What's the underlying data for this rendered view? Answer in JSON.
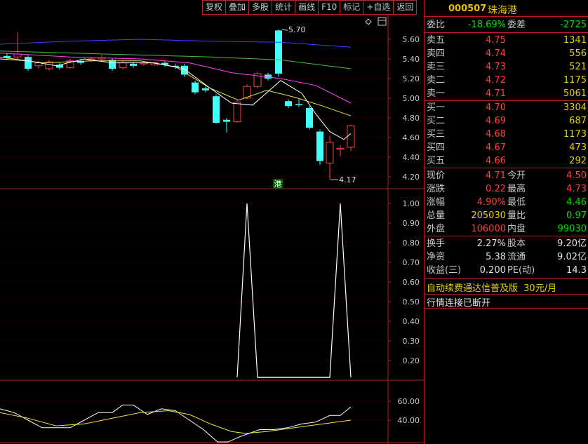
{
  "toolbar": {
    "buttons": [
      "复权",
      "叠加",
      "多股",
      "统计",
      "画线",
      "F10",
      "标记",
      "+自选",
      "返回"
    ]
  },
  "stock": {
    "code": "000507",
    "name": "珠海港"
  },
  "main_chart": {
    "y_ticks": [
      "5.60",
      "5.40",
      "5.20",
      "5.00",
      "4.80",
      "4.60",
      "4.40",
      "4.20"
    ],
    "high_label": "5.70",
    "low_label": "4.17",
    "badge": "港"
  },
  "indicator1": {
    "y_ticks": [
      "1.00",
      "0.90",
      "0.80",
      "0.70",
      "0.60",
      "0.50",
      "0.40",
      "0.30",
      "0.20"
    ]
  },
  "indicator2": {
    "y_ticks": [
      "60.00",
      "40.00"
    ]
  },
  "quote": {
    "weibi_label": "委比",
    "weibi": "-18.69%",
    "weicha_label": "委差",
    "weicha": "-2725",
    "sells": [
      {
        "label": "卖五",
        "price": "4.75",
        "vol": "1341"
      },
      {
        "label": "卖四",
        "price": "4.74",
        "vol": "556"
      },
      {
        "label": "卖三",
        "price": "4.73",
        "vol": "521"
      },
      {
        "label": "卖二",
        "price": "4.72",
        "vol": "1175"
      },
      {
        "label": "卖一",
        "price": "4.71",
        "vol": "5061"
      }
    ],
    "buys": [
      {
        "label": "买一",
        "price": "4.70",
        "vol": "3304"
      },
      {
        "label": "买二",
        "price": "4.69",
        "vol": "687"
      },
      {
        "label": "买三",
        "price": "4.68",
        "vol": "1173"
      },
      {
        "label": "买四",
        "price": "4.67",
        "vol": "473"
      },
      {
        "label": "买五",
        "price": "4.66",
        "vol": "292"
      }
    ],
    "stats": [
      {
        "l1": "现价",
        "v1": "4.71",
        "c1": "red",
        "l2": "今开",
        "v2": "4.50",
        "c2": "red"
      },
      {
        "l1": "涨跌",
        "v1": "0.22",
        "c1": "red",
        "l2": "最高",
        "v2": "4.73",
        "c2": "red"
      },
      {
        "l1": "涨幅",
        "v1": "4.90%",
        "c1": "red",
        "l2": "最低",
        "v2": "4.46",
        "c2": "green"
      },
      {
        "l1": "总量",
        "v1": "205030",
        "c1": "yellow",
        "l2": "量比",
        "v2": "0.97",
        "c2": "green"
      },
      {
        "l1": "外盘",
        "v1": "106000",
        "c1": "red",
        "l2": "内盘",
        "v2": "99030",
        "c2": "green"
      }
    ],
    "stats2": [
      {
        "l1": "换手",
        "v1": "2.27%",
        "l2": "股本",
        "v2": "9.20亿"
      },
      {
        "l1": "净资",
        "v1": "5.38",
        "l2": "流通",
        "v2": "9.02亿"
      },
      {
        "l1": "收益(三)",
        "v1": "0.200",
        "l2": "PE(动)",
        "v2": "14.3"
      }
    ],
    "ad_text": "自动续费通达信普及版",
    "ad_price": "30元/月",
    "status": "行情连接已断开"
  },
  "colors": {
    "up": "#ff4040",
    "down": "#40ffff",
    "ma1": "#ffffff",
    "ma2": "#e8e840",
    "ma3": "#ff40ff",
    "ma4": "#40c040",
    "ma5": "#4040ff",
    "border": "#b02020"
  }
}
